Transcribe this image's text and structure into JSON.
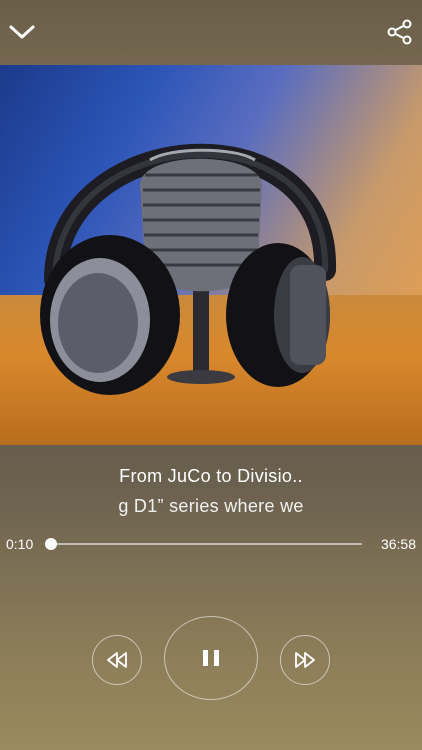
{
  "header": {
    "collapse_icon": "chevron-down-icon",
    "share_icon": "share-icon"
  },
  "artwork": {
    "description_icon": "podcast-artwork"
  },
  "track": {
    "title": "From JuCo to Divisio..",
    "subtitle": "g D1” series where we"
  },
  "progress": {
    "current_time": "0:10",
    "total_time": "36:58",
    "fraction": 0.0045
  },
  "controls": {
    "rewind_icon": "rewind-icon",
    "pause_icon": "pause-icon",
    "forward_icon": "fast-forward-icon"
  },
  "colors": {
    "text": "#ffffff",
    "background": "#6b614f"
  }
}
